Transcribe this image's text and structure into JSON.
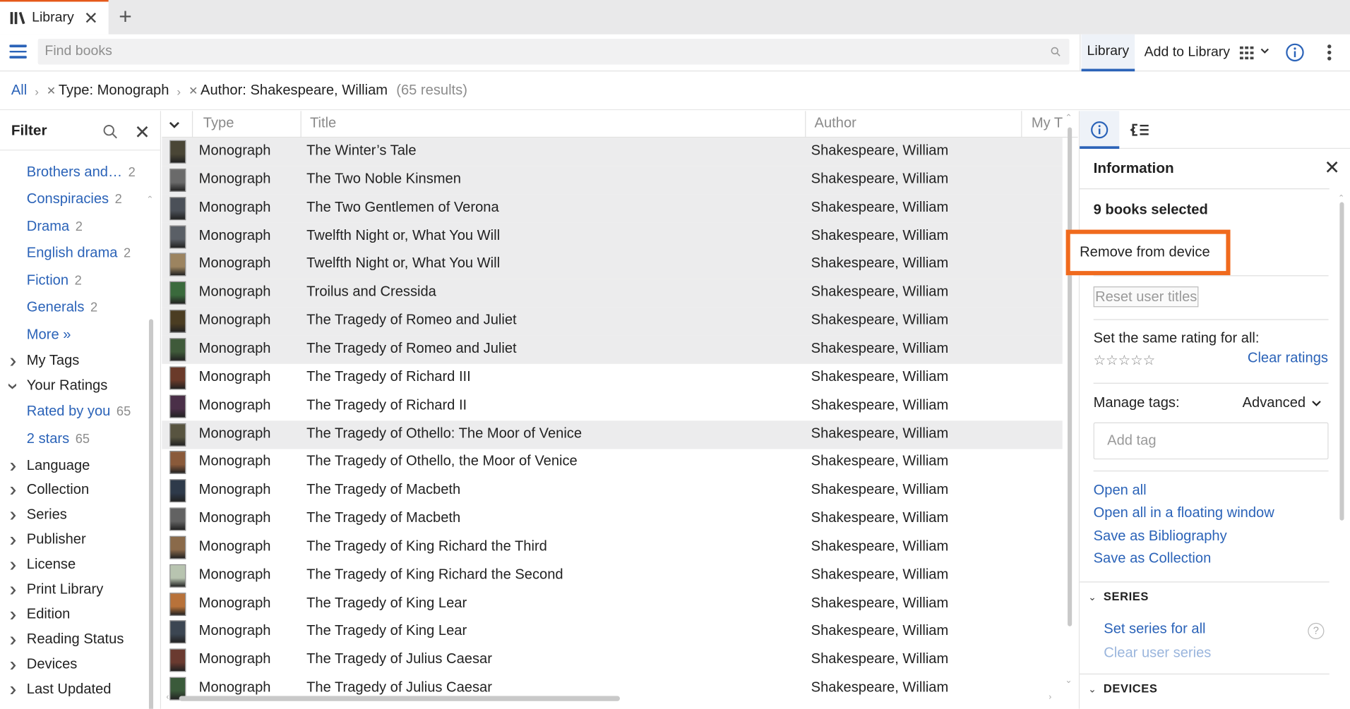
{
  "tab": {
    "title": "Library",
    "close": "✕",
    "new": "+"
  },
  "toolbar": {
    "search_placeholder": "Find books",
    "library_label": "Library",
    "add_label": "Add to Library"
  },
  "breadcrumb": {
    "all": "All",
    "filter1": "Type: Monograph",
    "filter2": "Author: Shakespeare, William",
    "results": "(65 results)"
  },
  "filter": {
    "title": "Filter",
    "items": [
      {
        "label": "Brothers and…",
        "count": "2"
      },
      {
        "label": "Conspiracies",
        "count": "2"
      },
      {
        "label": "Drama",
        "count": "2"
      },
      {
        "label": "English drama",
        "count": "2"
      },
      {
        "label": "Fiction",
        "count": "2"
      },
      {
        "label": "Generals",
        "count": "2"
      }
    ],
    "more": "More »",
    "my_tags": "My Tags",
    "your_ratings": "Your Ratings",
    "rated_by_you": {
      "label": "Rated by you",
      "count": "65"
    },
    "two_stars": {
      "label": "2 stars",
      "count": "65"
    },
    "categories": [
      "Language",
      "Collection",
      "Series",
      "Publisher",
      "License",
      "Print Library",
      "Edition",
      "Reading Status",
      "Devices",
      "Last Updated"
    ]
  },
  "grid": {
    "headers": {
      "type": "Type",
      "title": "Title",
      "author": "Author",
      "mytags": "My T"
    },
    "rows": [
      {
        "type": "Monograph",
        "title": "The Winter’s Tale",
        "author": "Shakespeare, William",
        "selected": true,
        "cover": "#4a4636"
      },
      {
        "type": "Monograph",
        "title": "The Two Noble Kinsmen",
        "author": "Shakespeare, William",
        "selected": true,
        "cover": "#6a6a6a"
      },
      {
        "type": "Monograph",
        "title": "The Two Gentlemen of Verona",
        "author": "Shakespeare, William",
        "selected": true,
        "cover": "#4b5058"
      },
      {
        "type": "Monograph",
        "title": "Twelfth Night or, What You Will",
        "author": "Shakespeare, William",
        "selected": true,
        "cover": "#5a5f66"
      },
      {
        "type": "Monograph",
        "title": "Twelfth Night or, What You Will",
        "author": "Shakespeare, William",
        "selected": true,
        "cover": "#9c8460"
      },
      {
        "type": "Monograph",
        "title": "Troilus and Cressida",
        "author": "Shakespeare, William",
        "selected": true,
        "cover": "#3a6a3c"
      },
      {
        "type": "Monograph",
        "title": "The Tragedy of Romeo and Juliet",
        "author": "Shakespeare, William",
        "selected": true,
        "cover": "#4b3d22"
      },
      {
        "type": "Monograph",
        "title": "The Tragedy of Romeo and Juliet",
        "author": "Shakespeare, William",
        "selected": true,
        "cover": "#3f5a3a"
      },
      {
        "type": "Monograph",
        "title": "The Tragedy of Richard III",
        "author": "Shakespeare, William",
        "selected": false,
        "cover": "#6a3a2a"
      },
      {
        "type": "Monograph",
        "title": "The Tragedy of Richard II",
        "author": "Shakespeare, William",
        "selected": false,
        "cover": "#4a2f48"
      },
      {
        "type": "Monograph",
        "title": "The Tragedy of Othello: The Moor of Venice",
        "author": "Shakespeare, William",
        "selected": true,
        "cover": "#585440"
      },
      {
        "type": "Monograph",
        "title": "The Tragedy of Othello, the Moor of Venice",
        "author": "Shakespeare, William",
        "selected": false,
        "cover": "#8a5a3a"
      },
      {
        "type": "Monograph",
        "title": "The Tragedy of Macbeth",
        "author": "Shakespeare, William",
        "selected": false,
        "cover": "#2e3a4a"
      },
      {
        "type": "Monograph",
        "title": "The Tragedy of Macbeth",
        "author": "Shakespeare, William",
        "selected": false,
        "cover": "#626262"
      },
      {
        "type": "Monograph",
        "title": "The Tragedy of King Richard the Third",
        "author": "Shakespeare, William",
        "selected": false,
        "cover": "#8a6a4a"
      },
      {
        "type": "Monograph",
        "title": "The Tragedy of King Richard the Second",
        "author": "Shakespeare, William",
        "selected": false,
        "cover": "#b8c4b0"
      },
      {
        "type": "Monograph",
        "title": "The Tragedy of King Lear",
        "author": "Shakespeare, William",
        "selected": false,
        "cover": "#b8723a"
      },
      {
        "type": "Monograph",
        "title": "The Tragedy of King Lear",
        "author": "Shakespeare, William",
        "selected": false,
        "cover": "#3c4652"
      },
      {
        "type": "Monograph",
        "title": "The Tragedy of Julius Caesar",
        "author": "Shakespeare, William",
        "selected": false,
        "cover": "#6a3a30"
      },
      {
        "type": "Monograph",
        "title": "The Tragedy of Julius Caesar",
        "author": "Shakespeare, William",
        "selected": false,
        "cover": "#3a5a3a"
      }
    ]
  },
  "panel": {
    "title": "Information",
    "selected": "9 books selected",
    "remove": "Remove from device",
    "reset": "Reset user titles",
    "rating_label": "Set the same rating for all:",
    "stars": "☆☆☆☆☆",
    "clear_ratings": "Clear ratings",
    "tags_label": "Manage tags:",
    "advanced": "Advanced",
    "tag_placeholder": "Add tag",
    "links": [
      "Open all",
      "Open all in a floating window",
      "Save as Bibliography",
      "Save as Collection"
    ],
    "series_head": "SERIES",
    "set_series": "Set series for all",
    "clear_series": "Clear user series",
    "devices_head": "DEVICES",
    "help": "?"
  },
  "colors": {
    "accent": "#2b63b8",
    "highlight": "#f06a1d",
    "selected_row": "#ececed"
  }
}
